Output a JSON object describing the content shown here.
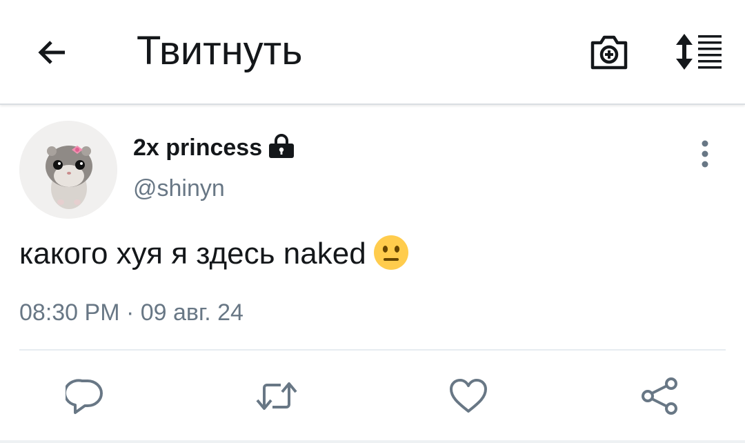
{
  "appbar": {
    "title": "Твитнуть",
    "back_icon": "arrow-left-icon",
    "camera_icon": "camera-plus-icon",
    "sort_icon": "sort-list-icon"
  },
  "tweet": {
    "author_name": "2x princess",
    "locked_icon": "lock-icon",
    "handle": "@shinyn",
    "text": "какого хуя я здесь naked",
    "emoji": "neutral-face-emoji",
    "timestamp": "08:30 PM · 09 авг. 24",
    "more_icon": "more-vertical-icon"
  },
  "actions": [
    {
      "name": "reply",
      "icon": "reply-bubble-icon"
    },
    {
      "name": "retweet",
      "icon": "retweet-icon"
    },
    {
      "name": "like",
      "icon": "heart-icon"
    },
    {
      "name": "share",
      "icon": "share-icon"
    }
  ],
  "colors": {
    "text_primary": "#14171a",
    "text_secondary": "#687785",
    "icon_gray": "#687785",
    "divider": "#e6ecf0",
    "emoji_yellow": "#ffcc4d"
  }
}
